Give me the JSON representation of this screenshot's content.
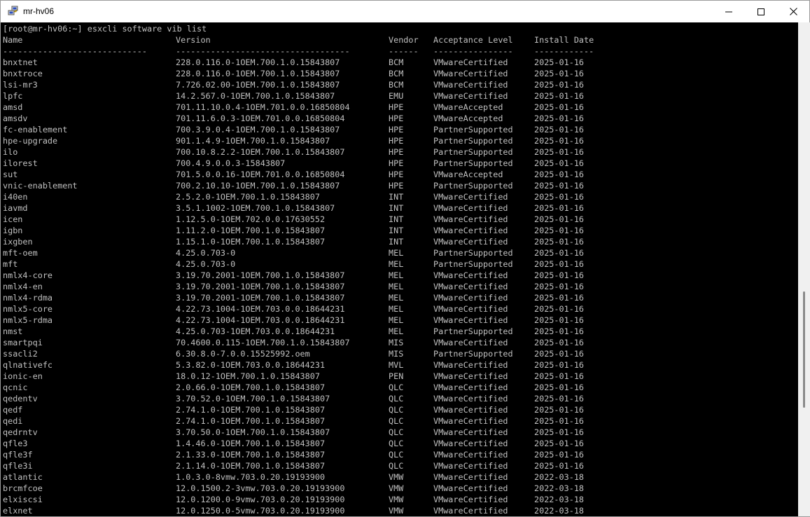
{
  "window": {
    "title": "mr-hv06",
    "icon": "putty-icon",
    "controls": [
      "minimize-icon",
      "maximize-icon",
      "close-icon"
    ]
  },
  "terminal": {
    "prompt": "[root@mr-hv06:~] esxcli software vib list",
    "headers": [
      "Name",
      "Version",
      "Vendor",
      "Acceptance Level",
      "Install Date"
    ],
    "separators": [
      "-----------------------------",
      "-----------------------------------",
      "------",
      "----------------",
      "------------"
    ],
    "rows": [
      [
        "bnxtnet",
        "228.0.116.0-1OEM.700.1.0.15843807",
        "BCM",
        "VMwareCertified",
        "2025-01-16"
      ],
      [
        "bnxtroce",
        "228.0.116.0-1OEM.700.1.0.15843807",
        "BCM",
        "VMwareCertified",
        "2025-01-16"
      ],
      [
        "lsi-mr3",
        "7.726.02.00-1OEM.700.1.0.15843807",
        "BCM",
        "VMwareCertified",
        "2025-01-16"
      ],
      [
        "lpfc",
        "14.2.567.0-1OEM.700.1.0.15843807",
        "EMU",
        "VMwareCertified",
        "2025-01-16"
      ],
      [
        "amsd",
        "701.11.10.0.4-1OEM.701.0.0.16850804",
        "HPE",
        "VMwareAccepted",
        "2025-01-16"
      ],
      [
        "amsdv",
        "701.11.6.0.3-1OEM.701.0.0.16850804",
        "HPE",
        "VMwareAccepted",
        "2025-01-16"
      ],
      [
        "fc-enablement",
        "700.3.9.0.4-1OEM.700.1.0.15843807",
        "HPE",
        "PartnerSupported",
        "2025-01-16"
      ],
      [
        "hpe-upgrade",
        "901.1.4.9-1OEM.700.1.0.15843807",
        "HPE",
        "PartnerSupported",
        "2025-01-16"
      ],
      [
        "ilo",
        "700.10.8.2.2-1OEM.700.1.0.15843807",
        "HPE",
        "PartnerSupported",
        "2025-01-16"
      ],
      [
        "ilorest",
        "700.4.9.0.0.3-15843807",
        "HPE",
        "PartnerSupported",
        "2025-01-16"
      ],
      [
        "sut",
        "701.5.0.0.16-1OEM.701.0.0.16850804",
        "HPE",
        "VMwareAccepted",
        "2025-01-16"
      ],
      [
        "vnic-enablement",
        "700.2.10.10-1OEM.700.1.0.15843807",
        "HPE",
        "PartnerSupported",
        "2025-01-16"
      ],
      [
        "i40en",
        "2.5.2.0-1OEM.700.1.0.15843807",
        "INT",
        "VMwareCertified",
        "2025-01-16"
      ],
      [
        "iavmd",
        "3.5.1.1002-1OEM.700.1.0.15843807",
        "INT",
        "VMwareCertified",
        "2025-01-16"
      ],
      [
        "icen",
        "1.12.5.0-1OEM.702.0.0.17630552",
        "INT",
        "VMwareCertified",
        "2025-01-16"
      ],
      [
        "igbn",
        "1.11.2.0-1OEM.700.1.0.15843807",
        "INT",
        "VMwareCertified",
        "2025-01-16"
      ],
      [
        "ixgben",
        "1.15.1.0-1OEM.700.1.0.15843807",
        "INT",
        "VMwareCertified",
        "2025-01-16"
      ],
      [
        "mft-oem",
        "4.25.0.703-0",
        "MEL",
        "PartnerSupported",
        "2025-01-16"
      ],
      [
        "mft",
        "4.25.0.703-0",
        "MEL",
        "PartnerSupported",
        "2025-01-16"
      ],
      [
        "nmlx4-core",
        "3.19.70.2001-1OEM.700.1.0.15843807",
        "MEL",
        "VMwareCertified",
        "2025-01-16"
      ],
      [
        "nmlx4-en",
        "3.19.70.2001-1OEM.700.1.0.15843807",
        "MEL",
        "VMwareCertified",
        "2025-01-16"
      ],
      [
        "nmlx4-rdma",
        "3.19.70.2001-1OEM.700.1.0.15843807",
        "MEL",
        "VMwareCertified",
        "2025-01-16"
      ],
      [
        "nmlx5-core",
        "4.22.73.1004-1OEM.703.0.0.18644231",
        "MEL",
        "VMwareCertified",
        "2025-01-16"
      ],
      [
        "nmlx5-rdma",
        "4.22.73.1004-1OEM.703.0.0.18644231",
        "MEL",
        "VMwareCertified",
        "2025-01-16"
      ],
      [
        "nmst",
        "4.25.0.703-1OEM.703.0.0.18644231",
        "MEL",
        "PartnerSupported",
        "2025-01-16"
      ],
      [
        "smartpqi",
        "70.4600.0.115-1OEM.700.1.0.15843807",
        "MIS",
        "VMwareCertified",
        "2025-01-16"
      ],
      [
        "ssacli2",
        "6.30.8.0-7.0.0.15525992.oem",
        "MIS",
        "PartnerSupported",
        "2025-01-16"
      ],
      [
        "qlnativefc",
        "5.3.82.0-1OEM.703.0.0.18644231",
        "MVL",
        "VMwareCertified",
        "2025-01-16"
      ],
      [
        "ionic-en",
        "18.0.12-1OEM.700.1.0.15843807",
        "PEN",
        "VMwareCertified",
        "2025-01-16"
      ],
      [
        "qcnic",
        "2.0.66.0-1OEM.700.1.0.15843807",
        "QLC",
        "VMwareCertified",
        "2025-01-16"
      ],
      [
        "qedentv",
        "3.70.52.0-1OEM.700.1.0.15843807",
        "QLC",
        "VMwareCertified",
        "2025-01-16"
      ],
      [
        "qedf",
        "2.74.1.0-1OEM.700.1.0.15843807",
        "QLC",
        "VMwareCertified",
        "2025-01-16"
      ],
      [
        "qedi",
        "2.74.1.0-1OEM.700.1.0.15843807",
        "QLC",
        "VMwareCertified",
        "2025-01-16"
      ],
      [
        "qedrntv",
        "3.70.50.0-1OEM.700.1.0.15843807",
        "QLC",
        "VMwareCertified",
        "2025-01-16"
      ],
      [
        "qfle3",
        "1.4.46.0-1OEM.700.1.0.15843807",
        "QLC",
        "VMwareCertified",
        "2025-01-16"
      ],
      [
        "qfle3f",
        "2.1.33.0-1OEM.700.1.0.15843807",
        "QLC",
        "VMwareCertified",
        "2025-01-16"
      ],
      [
        "qfle3i",
        "2.1.14.0-1OEM.700.1.0.15843807",
        "QLC",
        "VMwareCertified",
        "2025-01-16"
      ],
      [
        "atlantic",
        "1.0.3.0-8vmw.703.0.20.19193900",
        "VMW",
        "VMwareCertified",
        "2022-03-18"
      ],
      [
        "brcmfcoe",
        "12.0.1500.2-3vmw.703.0.20.19193900",
        "VMW",
        "VMwareCertified",
        "2022-03-18"
      ],
      [
        "elxiscsi",
        "12.0.1200.0-9vmw.703.0.20.19193900",
        "VMW",
        "VMwareCertified",
        "2022-03-18"
      ],
      [
        "elxnet",
        "12.0.1250.0-5vmw.703.0.20.19193900",
        "VMW",
        "VMwareCertified",
        "2022-03-18"
      ]
    ]
  }
}
